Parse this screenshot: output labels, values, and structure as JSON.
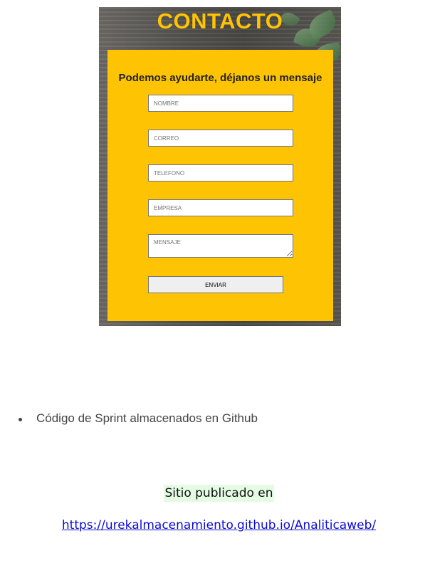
{
  "contact_card": {
    "title": "CONTACTO",
    "heading": "Podemos ayudarte, déjanos un mensaje",
    "fields": {
      "name_placeholder": "NOMBRE",
      "email_placeholder": "CORREO",
      "phone_placeholder": "TELEFONO",
      "company_placeholder": "EMPRESA",
      "message_placeholder": "MENSAJE"
    },
    "submit_label": "ENVIAR",
    "accent_color": "#fec404"
  },
  "bullets": [
    "Código de Sprint almacenados en Github"
  ],
  "published": {
    "label": "Sitio publicado en",
    "link_text": "https://urekalmacenamiento.github.io/Analiticaweb/",
    "link_color": "#0b0bd6",
    "highlight_color": "#e4fbe4"
  }
}
